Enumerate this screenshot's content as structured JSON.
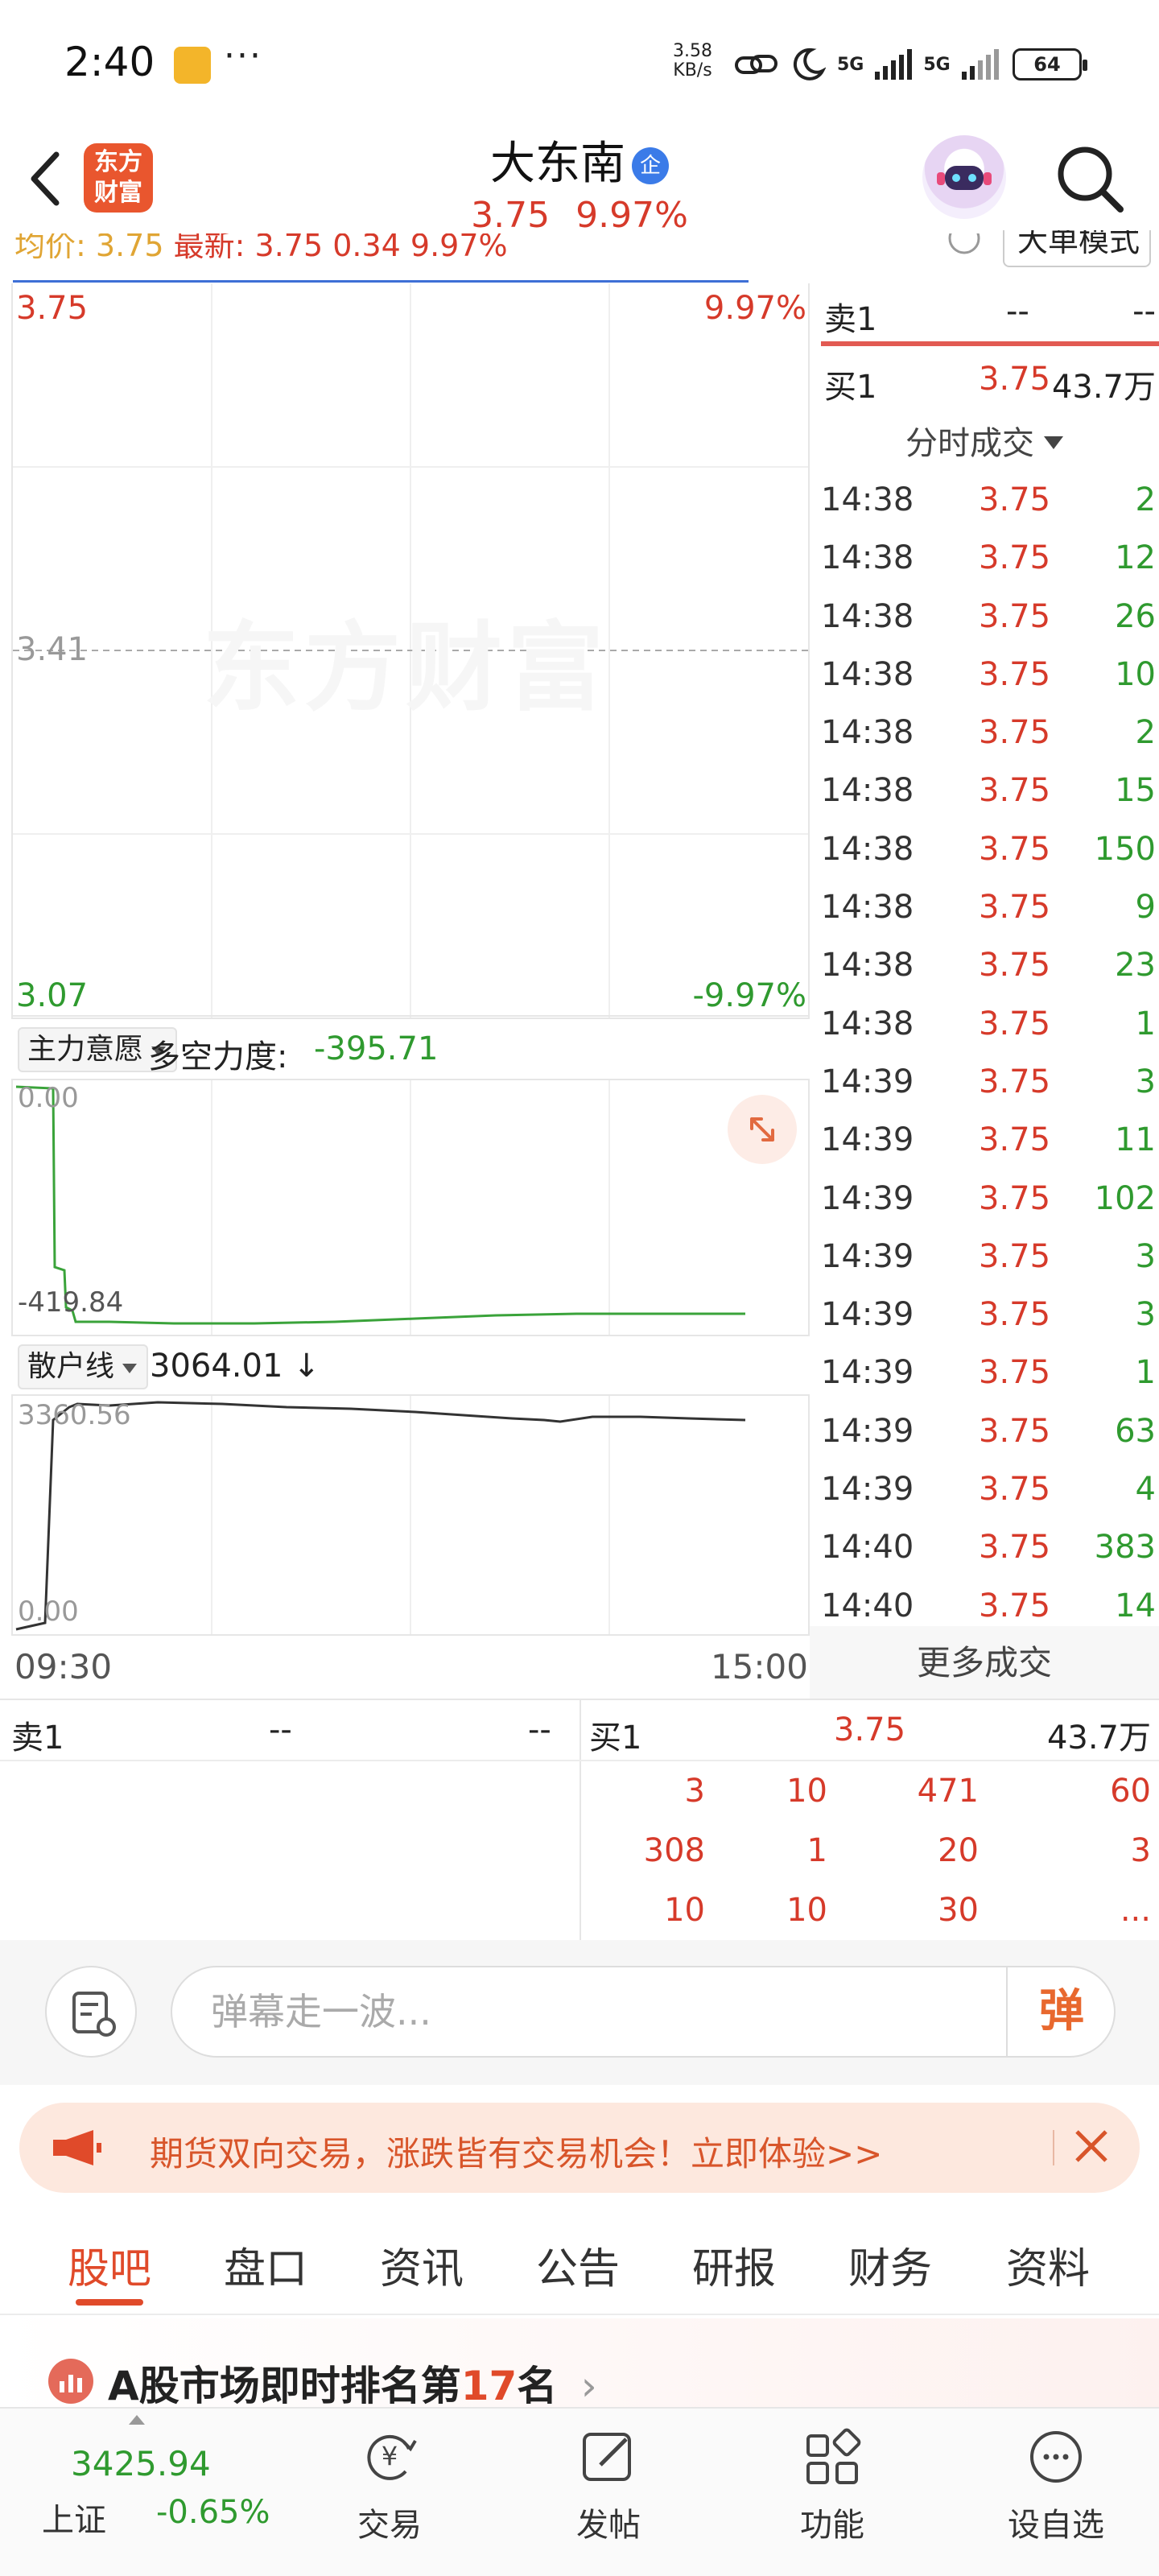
{
  "status_bar": {
    "time": "2:40",
    "more": "···",
    "net_speed_value": "3.58",
    "net_speed_unit": "KB/s",
    "sim1": "5G",
    "sim2": "5G",
    "battery": "64"
  },
  "header": {
    "logo_text": "东方财富",
    "stock_name": "大东南",
    "badge": "企",
    "price": "3.75",
    "change_pct": "9.97%"
  },
  "avg_info": {
    "avg_label": "均价:",
    "avg_value": "3.75",
    "latest_label": "最新:",
    "latest_value": "3.75",
    "change": "0.34",
    "change_pct": "9.97%",
    "mode_button": "大单模式"
  },
  "price_chart": {
    "high_price": "3.75",
    "high_pct": "9.97%",
    "prev_close": "3.41",
    "low_price": "3.07",
    "low_pct": "-9.97%",
    "watermark": "东方财富"
  },
  "indicator1": {
    "selector": "主力意愿",
    "label": "多空力度:",
    "value": "-395.71",
    "axis_top": "0.00",
    "axis_bottom": "-419.84"
  },
  "indicator2": {
    "selector": "散户线",
    "value": "3064.01",
    "arrow": "↓",
    "axis_top": "3360.56",
    "axis_bottom": "0.00"
  },
  "time_axis": {
    "start": "09:30",
    "end": "15:00"
  },
  "order_book_right": {
    "sell1_label": "卖1",
    "sell1_price": "--",
    "sell1_vol": "--",
    "buy1_label": "买1",
    "buy1_price": "3.75",
    "buy1_vol": "43.7万"
  },
  "trades": {
    "header": "分时成交",
    "rows": [
      {
        "time": "14:38",
        "price": "3.75",
        "vol": "2"
      },
      {
        "time": "14:38",
        "price": "3.75",
        "vol": "12"
      },
      {
        "time": "14:38",
        "price": "3.75",
        "vol": "26"
      },
      {
        "time": "14:38",
        "price": "3.75",
        "vol": "10"
      },
      {
        "time": "14:38",
        "price": "3.75",
        "vol": "2"
      },
      {
        "time": "14:38",
        "price": "3.75",
        "vol": "15"
      },
      {
        "time": "14:38",
        "price": "3.75",
        "vol": "150"
      },
      {
        "time": "14:38",
        "price": "3.75",
        "vol": "9"
      },
      {
        "time": "14:38",
        "price": "3.75",
        "vol": "23"
      },
      {
        "time": "14:38",
        "price": "3.75",
        "vol": "1"
      },
      {
        "time": "14:39",
        "price": "3.75",
        "vol": "3"
      },
      {
        "time": "14:39",
        "price": "3.75",
        "vol": "11"
      },
      {
        "time": "14:39",
        "price": "3.75",
        "vol": "102"
      },
      {
        "time": "14:39",
        "price": "3.75",
        "vol": "3"
      },
      {
        "time": "14:39",
        "price": "3.75",
        "vol": "3"
      },
      {
        "time": "14:39",
        "price": "3.75",
        "vol": "1"
      },
      {
        "time": "14:39",
        "price": "3.75",
        "vol": "63"
      },
      {
        "time": "14:39",
        "price": "3.75",
        "vol": "4"
      },
      {
        "time": "14:40",
        "price": "3.75",
        "vol": "383"
      },
      {
        "time": "14:40",
        "price": "3.75",
        "vol": "14"
      }
    ],
    "more": "更多成交"
  },
  "order_book_bottom": {
    "sell1_label": "卖1",
    "sell1_price": "--",
    "sell1_vol": "--",
    "buy1_label": "买1",
    "buy1_price": "3.75",
    "buy1_vol": "43.7万",
    "queue": [
      [
        "3",
        "10",
        "471",
        "60"
      ],
      [
        "308",
        "1",
        "20",
        "3"
      ],
      [
        "10",
        "10",
        "30",
        "..."
      ]
    ]
  },
  "comment_bar": {
    "placeholder": "弹幕走一波...",
    "danmu_button": "弹"
  },
  "promo": {
    "text": "期货双向交易，涨跌皆有交易机会！立即体验>>"
  },
  "tabs": [
    "股吧",
    "盘口",
    "资讯",
    "公告",
    "研报",
    "财务",
    "资料"
  ],
  "rank": {
    "prefix": "A股市场即时排名第",
    "number": "17",
    "suffix": "名",
    "arrow": "›"
  },
  "bottom_nav": {
    "index_value": "3425.94",
    "index_name": "上证",
    "index_change": "-0.65%",
    "items": [
      "交易",
      "发帖",
      "功能",
      "设自选"
    ]
  },
  "colors": {
    "up": "#d63a2a",
    "down": "#2f9a2f",
    "brand": "#e9562e",
    "avg_line": "#3e6fd6"
  }
}
